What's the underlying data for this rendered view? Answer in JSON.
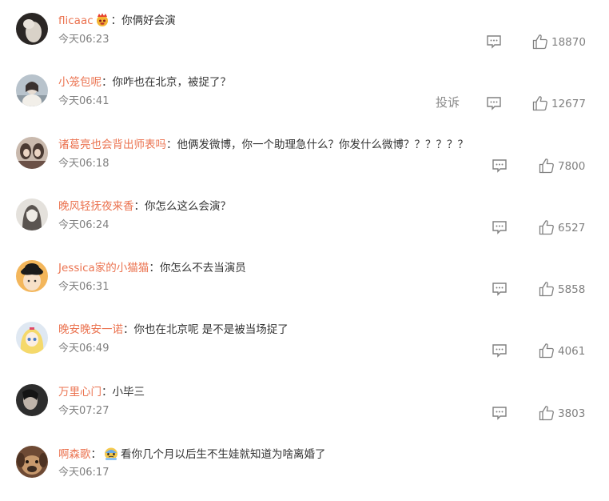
{
  "comments": [
    {
      "username": "flicaac",
      "separator": "：",
      "has_emoji": true,
      "emoji": "crown-face-emoji",
      "text": "你俩好会演",
      "time": "今天06:23",
      "likes": "18870",
      "report": ""
    },
    {
      "username": "小笼包呢",
      "separator": "：",
      "has_emoji": false,
      "text": "你咋也在北京，被捉了？",
      "time": "今天06:41",
      "likes": "12677",
      "report": "投诉"
    },
    {
      "username": "诸葛亮也会背出师表吗",
      "separator": "：",
      "has_emoji": false,
      "text": "他俩发微博，你一个助理急什么？你发什么微博？？？？？？",
      "time": "今天06:18",
      "likes": "7800",
      "report": ""
    },
    {
      "username": "晚风轻抚夜来香",
      "separator": "：",
      "has_emoji": false,
      "text": "你怎么这么会演？",
      "time": "今天06:24",
      "likes": "6527",
      "report": ""
    },
    {
      "username": "Jessica家的小猫猫",
      "separator": "：",
      "has_emoji": false,
      "text": "你怎么不去当演员",
      "time": "今天06:31",
      "likes": "5858",
      "report": ""
    },
    {
      "username": "晚安晚安一诺",
      "separator": "：",
      "has_emoji": false,
      "text": "你也在北京呢 是不是被当场捉了",
      "time": "今天06:49",
      "likes": "4061",
      "report": ""
    },
    {
      "username": "万里心门",
      "separator": "：",
      "has_emoji": false,
      "text": "小毕三",
      "time": "今天07:27",
      "likes": "3803",
      "report": ""
    },
    {
      "username": "啊森歌",
      "separator": "：",
      "has_emoji": true,
      "emoji": "sweat-face-emoji",
      "text": "看你几个月以后生不生娃就知道为啥离婚了",
      "time": "今天06:17",
      "likes": "",
      "report": ""
    }
  ],
  "icons": {
    "comment": "comment-bubble-icon",
    "like": "thumbs-up-icon"
  },
  "colors": {
    "username": "#eb7350",
    "text": "#333333",
    "meta": "#808080"
  }
}
